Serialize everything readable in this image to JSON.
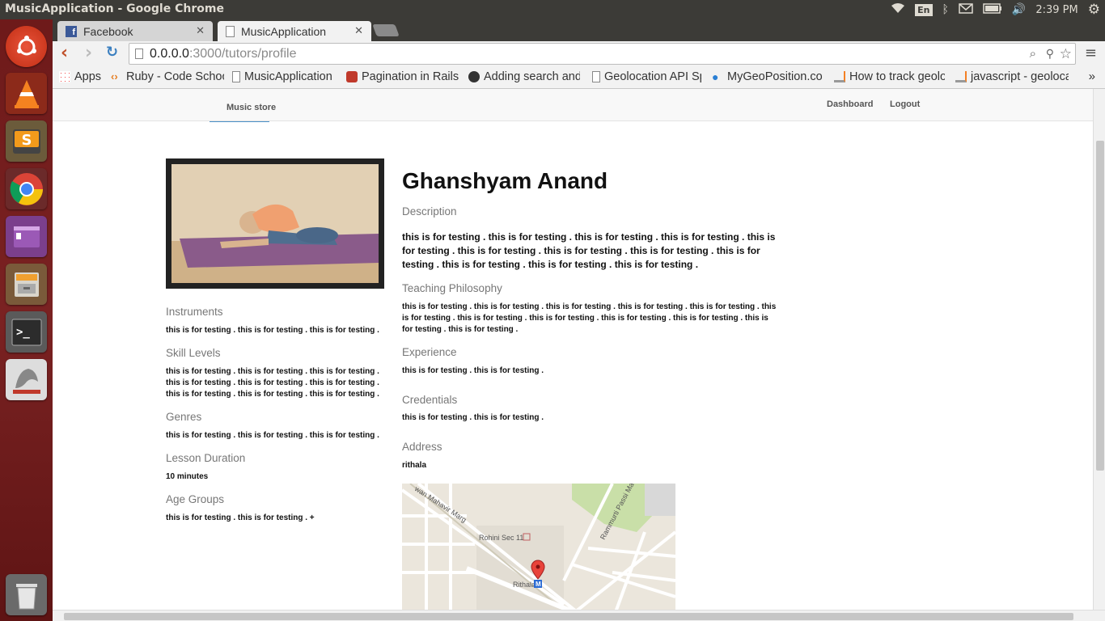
{
  "os": {
    "window_title": "MusicApplication - Google Chrome",
    "input_method": "En",
    "clock": "2:39 PM"
  },
  "browser": {
    "tabs": [
      {
        "label": "Facebook",
        "icon": "facebook-icon"
      },
      {
        "label": "MusicApplication",
        "icon": "page-icon"
      }
    ],
    "url_host": "0.0.0.0",
    "url_path": ":3000/tutors/profile",
    "bookmarks": [
      {
        "label": "Apps",
        "icon": "apps-icon"
      },
      {
        "label": "Ruby - Code Schoo",
        "icon": "code-icon"
      },
      {
        "label": "MusicApplication",
        "icon": "page-icon"
      },
      {
        "label": "Pagination in Rails",
        "icon": "rails-icon"
      },
      {
        "label": "Adding search and",
        "icon": "github-icon"
      },
      {
        "label": "Geolocation API Sp",
        "icon": "page-icon"
      },
      {
        "label": "MyGeoPosition.co",
        "icon": "map-pin-icon"
      },
      {
        "label": "How to track geolo",
        "icon": "stackoverflow-icon"
      },
      {
        "label": "javascript - geoloca",
        "icon": "stackoverflow-icon"
      }
    ],
    "overflow": "»"
  },
  "nav": {
    "brand": "Music store",
    "dashboard": "Dashboard",
    "logout": "Logout"
  },
  "profile": {
    "name": "Ghanshyam Anand",
    "left_sections": [
      {
        "heading": "Instruments",
        "text": "this is for testing . this is for testing . this is for testing ."
      },
      {
        "heading": "Skill Levels",
        "text": "this is for testing . this is for testing . this is for testing . this is for testing . this is for testing . this is for testing . this is for testing . this is for testing . this is for testing ."
      },
      {
        "heading": "Genres",
        "text": "this is for testing . this is for testing . this is for testing ."
      },
      {
        "heading": "Lesson Duration",
        "text": "10 minutes"
      },
      {
        "heading": "Age Groups",
        "text": "this is for testing . this is for testing . +"
      }
    ],
    "description": {
      "heading": "Description",
      "text": "this is for testing . this is for testing . this is for testing . this is for testing . this is for testing . this is for testing . this is for testing . this is for testing . this is for testing . this is for testing . this is for testing . this is for testing ."
    },
    "teaching": {
      "heading": "Teaching Philosophy",
      "text": "this is for testing . this is for testing . this is for testing . this is for testing . this is for testing . this is for testing . this is for testing . this is for testing . this is for testing . this is for testing . this is for testing . this is for testing ."
    },
    "experience": {
      "heading": "Experience",
      "text": "this is for testing . this is for testing ."
    },
    "credentials": {
      "heading": "Credentials",
      "text": "this is for testing . this is for testing ."
    },
    "address": {
      "heading": "Address",
      "text": "rithala"
    },
    "map_labels": {
      "road1": "wan Mahavir Marg",
      "road2": "Rammurti Passi Ma",
      "place": "Rohini Sec 11",
      "station": "Rithala"
    }
  },
  "colors": {
    "launcher": "#7a2222",
    "panel": "#3c3b37",
    "link_underline": "#4a90c8"
  }
}
